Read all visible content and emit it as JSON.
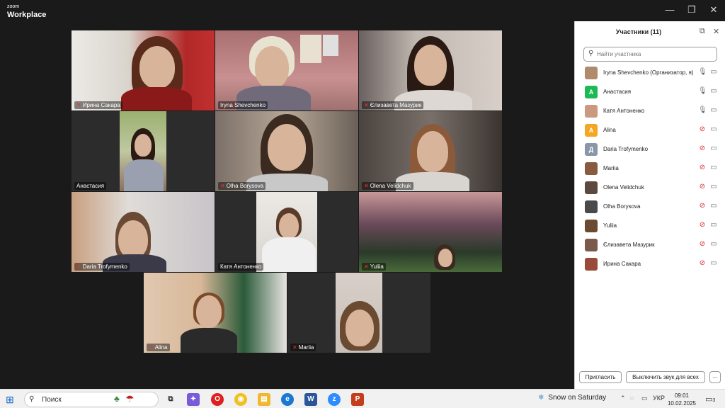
{
  "app": {
    "logo_line1": "zoom",
    "logo_line2": "Workplace"
  },
  "window_controls": {
    "minimize": "—",
    "maximize": "❐",
    "close": "✕"
  },
  "gallery": {
    "tiles": [
      {
        "name": "Ирина Сакара",
        "muted": true
      },
      {
        "name": "Iryna Shevchenko",
        "muted": false
      },
      {
        "name": "Єлизавета Мазурик",
        "muted": true
      },
      {
        "name": "Анастасия",
        "muted": false
      },
      {
        "name": "Olha Borysova",
        "muted": true
      },
      {
        "name": "Olena Velidchuk",
        "muted": true
      },
      {
        "name": "Daria Trofymenko",
        "muted": true
      },
      {
        "name": "Катя Антоненко",
        "muted": false
      },
      {
        "name": "Yuliia",
        "muted": true
      },
      {
        "name": "Alina",
        "muted": true
      },
      {
        "name": "Mariia",
        "muted": true
      }
    ]
  },
  "panel": {
    "title": "Участники (11)",
    "search_placeholder": "Найти участника",
    "participants": [
      {
        "name": "Iryna Shevchenko (Организатор, я)",
        "avatar": "",
        "avatar_color": "#b08a6a",
        "muted": false
      },
      {
        "name": "Анастасия",
        "avatar": "А",
        "avatar_color": "#1db954",
        "muted": false
      },
      {
        "name": "Катя Антоненко",
        "avatar": "",
        "avatar_color": "#c99a80",
        "muted": false
      },
      {
        "name": "Alina",
        "avatar": "A",
        "avatar_color": "#f5a623",
        "muted": true
      },
      {
        "name": "Daria Trofymenko",
        "avatar": "Д",
        "avatar_color": "#8a97a8",
        "muted": true
      },
      {
        "name": "Mariia",
        "avatar": "",
        "avatar_color": "#8a5a40",
        "muted": true
      },
      {
        "name": "Olena Velidchuk",
        "avatar": "",
        "avatar_color": "#5a4a40",
        "muted": true
      },
      {
        "name": "Olha Borysova",
        "avatar": "",
        "avatar_color": "#4a4a4a",
        "muted": true
      },
      {
        "name": "Yuliia",
        "avatar": "",
        "avatar_color": "#6a4a30",
        "muted": true
      },
      {
        "name": "Єлизавета Мазурик",
        "avatar": "",
        "avatar_color": "#7a5a4a",
        "muted": true
      },
      {
        "name": "Ирина Сакара",
        "avatar": "",
        "avatar_color": "#9a4a3a",
        "muted": true
      }
    ],
    "invite_label": "Пригласить",
    "mute_all_label": "Выключить звук для всех",
    "more_label": "···"
  },
  "taskbar": {
    "search_text": "Поиск",
    "weather": "Snow on Saturday",
    "language": "УКР",
    "time": "09:01",
    "date": "10.02.2025",
    "notifications": "3"
  }
}
